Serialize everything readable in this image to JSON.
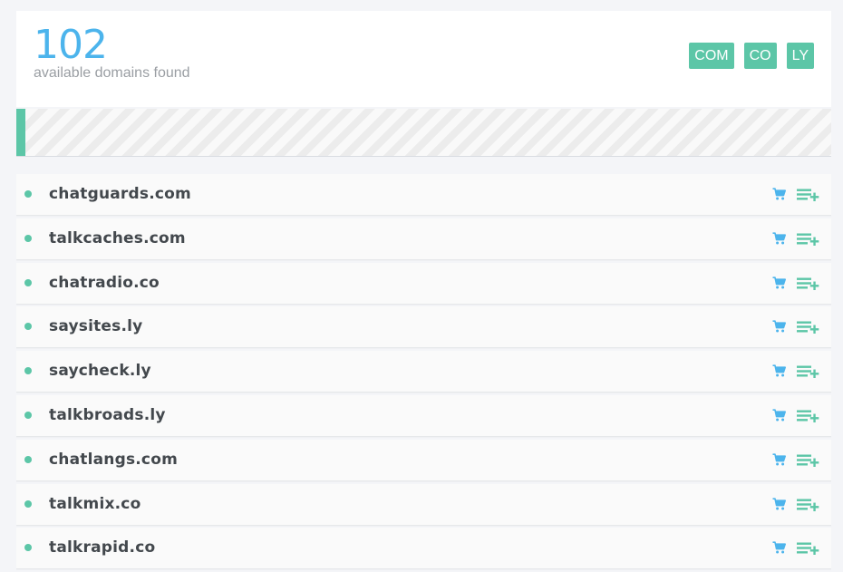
{
  "summary": {
    "count": "102",
    "label": "available domains found"
  },
  "filters": {
    "tlds": [
      "COM",
      "CO",
      "LY"
    ],
    "active_color": "#5cc6a7"
  },
  "progress": {
    "fraction": 0.011
  },
  "colors": {
    "accent_blue": "#4cb4ec",
    "accent_green": "#5cc6a7"
  },
  "results": [
    {
      "domain": "chatguards.com"
    },
    {
      "domain": "talkcaches.com"
    },
    {
      "domain": "chatradio.co"
    },
    {
      "domain": "saysites.ly"
    },
    {
      "domain": "saycheck.ly"
    },
    {
      "domain": "talkbroads.ly"
    },
    {
      "domain": "chatlangs.com"
    },
    {
      "domain": "talkmix.co"
    },
    {
      "domain": "talkrapid.co"
    }
  ],
  "icons": {
    "cart": "shopping-cart-icon",
    "add": "add-to-list-icon",
    "status": "status-dot-icon"
  }
}
